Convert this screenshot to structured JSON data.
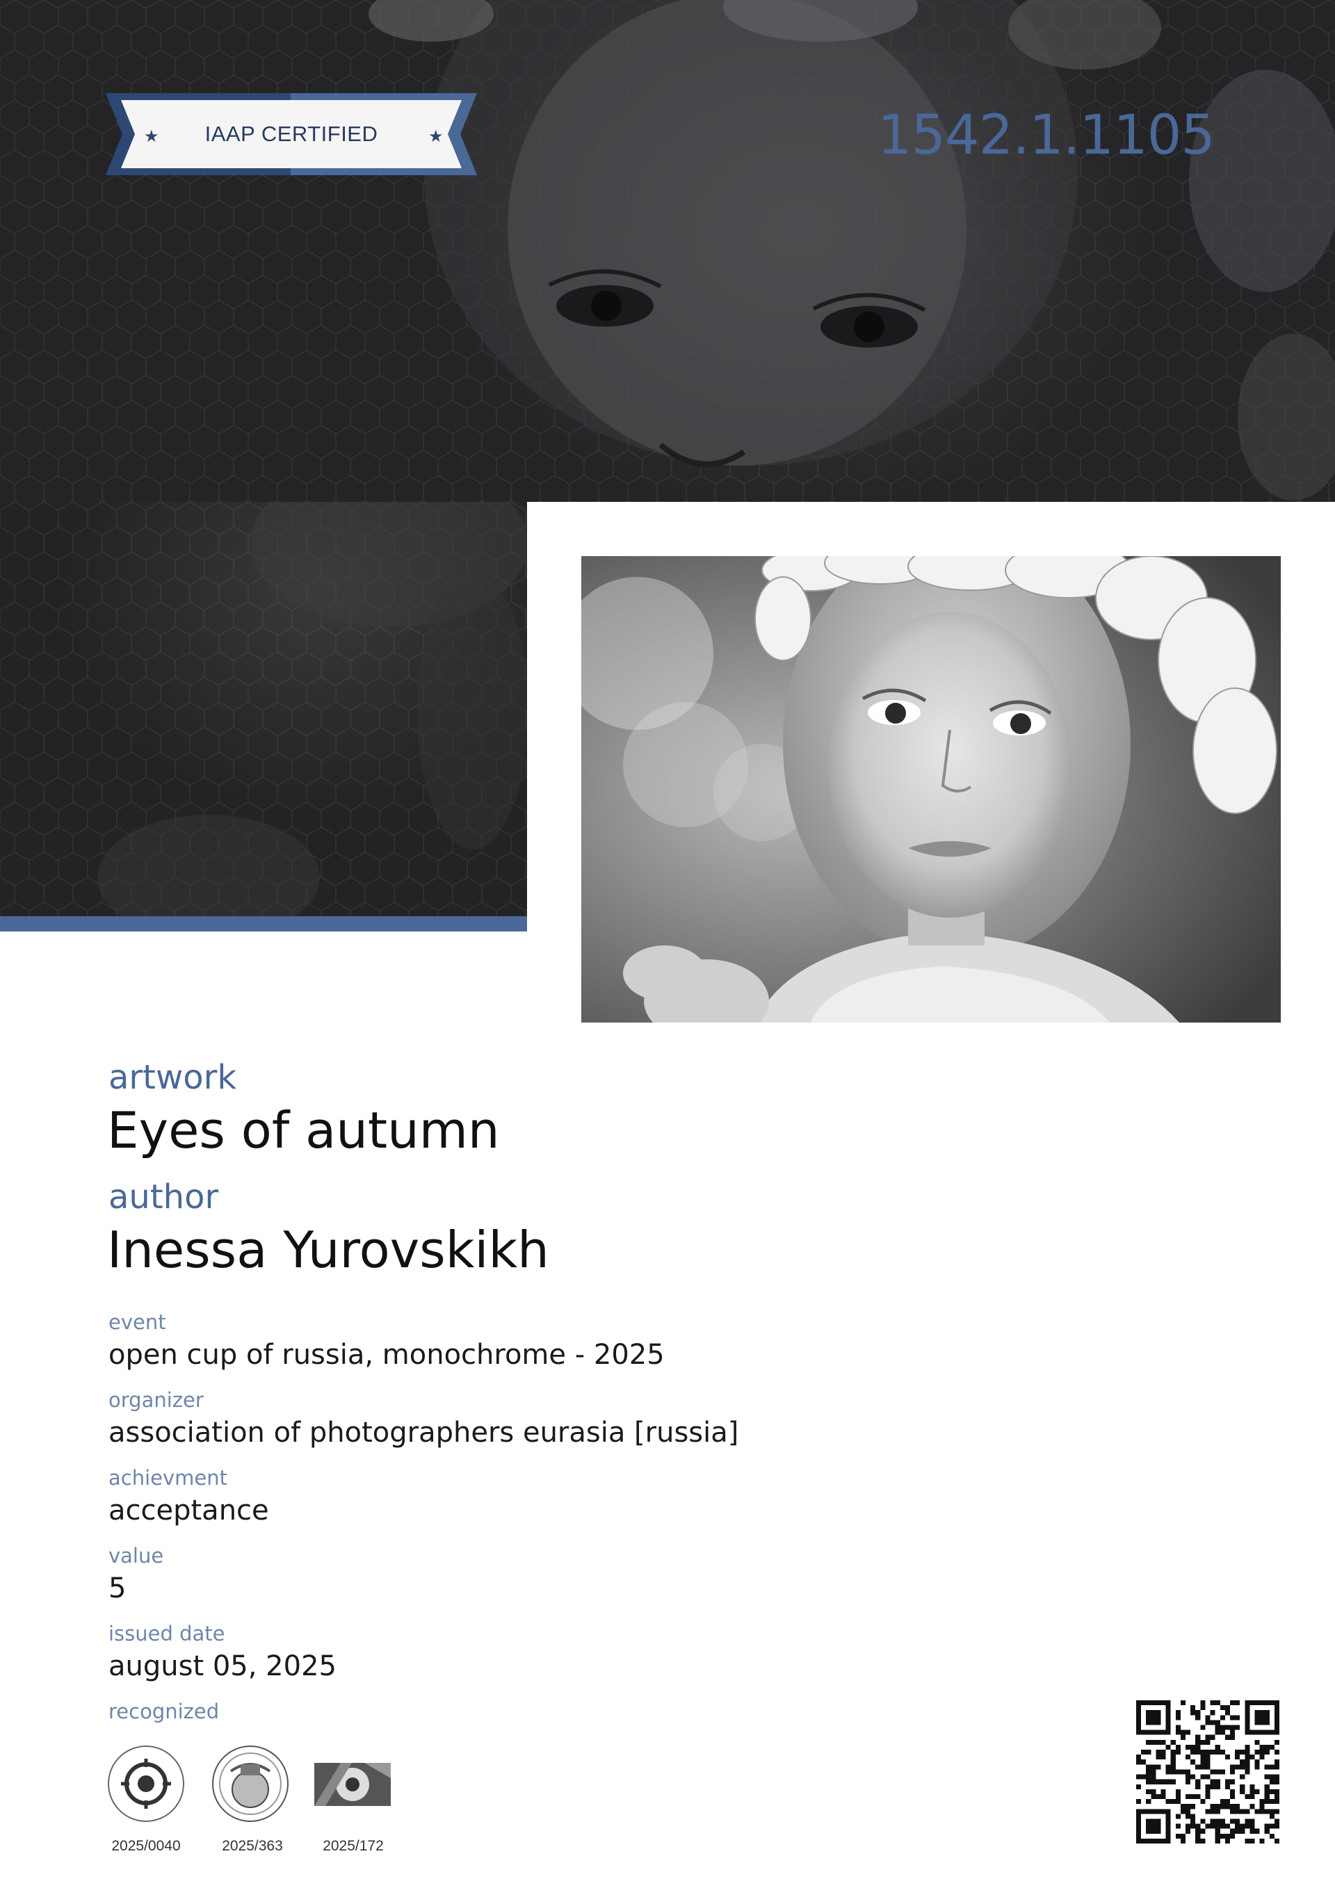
{
  "badge": {
    "label": "IAAP CERTIFIED"
  },
  "certificate_number": "1542.1.1105",
  "artwork": {
    "label": "artwork",
    "title": "Eyes of autumn"
  },
  "author": {
    "label": "author",
    "name": "Inessa Yurovskikh"
  },
  "details": [
    {
      "label": "event",
      "value": "open cup of russia, monochrome - 2025"
    },
    {
      "label": "organizer",
      "value": "association of photographers eurasia [russia]"
    },
    {
      "label": "achievment",
      "value": "acceptance"
    },
    {
      "label": "value",
      "value": "5"
    },
    {
      "label": "issued date",
      "value": "august 05, 2025"
    }
  ],
  "recognized": {
    "label": "recognized",
    "logos": [
      {
        "icon": "eurasia-association-logo",
        "code": "2025/0040"
      },
      {
        "icon": "fiap-logo",
        "code": "2025/363"
      },
      {
        "icon": "iaap-logo",
        "code": "2025/172"
      }
    ]
  },
  "colors": {
    "accent": "#4a6898",
    "ribbon_dark": "#253a60",
    "hero_dark": "#2a2a2c"
  },
  "photo": {
    "subject": "black-and-white portrait of a girl wearing a wreath of leaves"
  }
}
